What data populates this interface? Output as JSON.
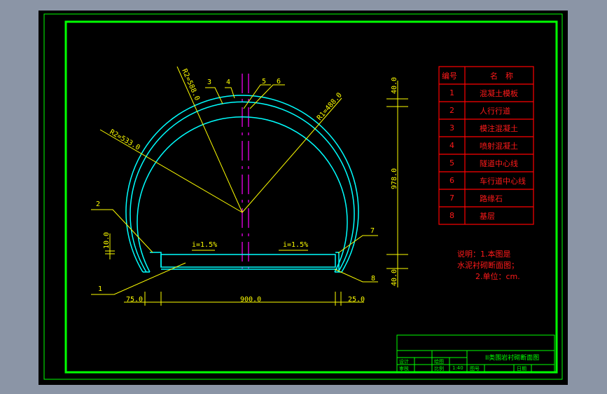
{
  "drawing": {
    "title": "II类围岩衬砌断面图",
    "colors": {
      "frame": "#00ff00",
      "lining": "#00ffff",
      "annotation": "#ffff00",
      "centerline": "#ff00ff",
      "table": "#ff0000"
    },
    "radii": {
      "r_top": "R2=588.0",
      "r_left": "R2=533.0",
      "r_right": "R1=488.0"
    },
    "callouts": [
      "1",
      "2",
      "3",
      "4",
      "5",
      "6",
      "7",
      "8"
    ],
    "slopes": {
      "left": "i=1.5%",
      "right": "i=1.5%"
    },
    "dims": {
      "left_walk": "75.0",
      "road_width": "900.0",
      "right_curb": "25.0",
      "walk_height": "10.0",
      "top_thk": "40.0",
      "height": "978.0",
      "bottom_thk": "40.0"
    }
  },
  "legend_table": {
    "headers": [
      "编号",
      "名　称"
    ],
    "rows": [
      {
        "no": "1",
        "name": "混凝土模板"
      },
      {
        "no": "2",
        "name": "人行行道"
      },
      {
        "no": "3",
        "name": "模注混凝土"
      },
      {
        "no": "4",
        "name": "喷射混凝土"
      },
      {
        "no": "5",
        "name": "隧道中心线"
      },
      {
        "no": "6",
        "name": "车行道中心线"
      },
      {
        "no": "7",
        "name": "路缘石"
      },
      {
        "no": "8",
        "name": "基层"
      }
    ]
  },
  "notes": [
    "说明：1.本图是",
    "水泥衬砌断面图；",
    "2.单位：cm."
  ],
  "title_block": {
    "design": "设计",
    "review": "审核",
    "drawn": "绘图",
    "scale_label": "比例",
    "scale": "1:40",
    "drawing_no": "图号",
    "date": "日期"
  }
}
